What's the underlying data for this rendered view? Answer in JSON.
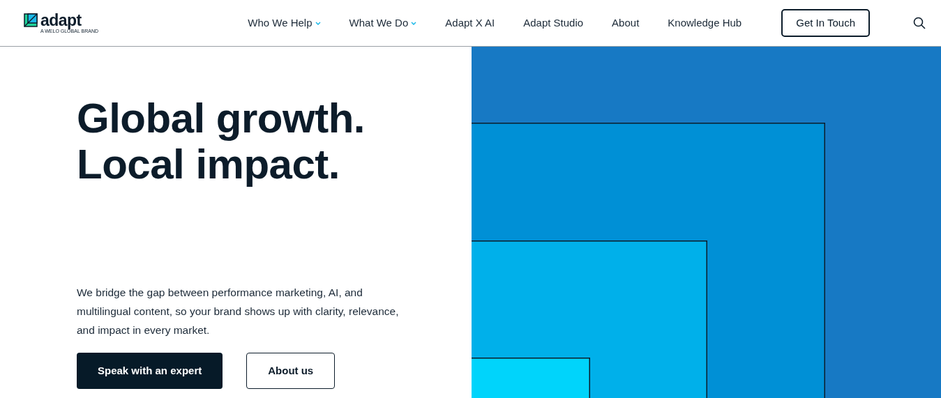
{
  "logo": {
    "name": "adapt",
    "tagline": "A WELO GLOBAL BRAND"
  },
  "nav": [
    {
      "label": "Who We Help",
      "kind": "dropdown"
    },
    {
      "label": "What We Do",
      "kind": "dropdown"
    },
    {
      "label": "Adapt X AI",
      "kind": "link"
    },
    {
      "label": "Adapt Studio",
      "kind": "link"
    },
    {
      "label": "About",
      "kind": "link"
    },
    {
      "label": "Knowledge Hub",
      "kind": "link"
    }
  ],
  "cta": "Get In Touch",
  "hero": {
    "headline": [
      "Global growth.",
      "Local impact."
    ],
    "text": "We bridge the gap between performance marketing, AI, and multilingual content, so your brand shows up with clarity, relevance, and impact in every market.",
    "buttons": [
      {
        "label": "Speak with an expert",
        "kind": "primary"
      },
      {
        "label": "About us",
        "kind": "outline"
      }
    ]
  }
}
